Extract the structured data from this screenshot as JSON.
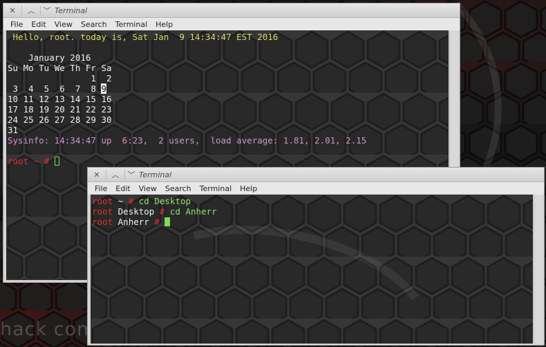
{
  "desktop": {
    "wallpaper_text": "hack computer"
  },
  "window1": {
    "title": "Terminal",
    "menu": [
      "File",
      "Edit",
      "View",
      "Search",
      "Terminal",
      "Help"
    ],
    "greeting": " Hello, root. today is, Sat Jan  9 14:34:47 EST 2016",
    "calendar": {
      "month_line": "    January 2016",
      "weekday_line": "Su Mo Tu We Th Fr Sa",
      "row1": "                1  2",
      "row2_before": " 3  4  5  6  7  8 ",
      "today": "9",
      "row3": "10 11 12 13 14 15 16",
      "row4": "17 18 19 20 21 22 23",
      "row5": "24 25 26 27 28 29 30",
      "row6": "31"
    },
    "sysinfo": "Sysinfo: 14:34:47 up  6:23,  2 users,  load average: 1.81, 2.01, 2.15",
    "prompt_user": "root",
    "prompt_dir": "~",
    "prompt_symbol": "#"
  },
  "window2": {
    "title": "Terminal",
    "menu": [
      "File",
      "Edit",
      "View",
      "Search",
      "Terminal",
      "Help"
    ],
    "lines": [
      {
        "user": "root",
        "dir": "~",
        "symbol": "#",
        "command": "cd Desktop"
      },
      {
        "user": "root",
        "dir": "Desktop",
        "symbol": "#",
        "command": "cd Anherr"
      },
      {
        "user": "root",
        "dir": "Anherr",
        "symbol": "#",
        "command": ""
      }
    ]
  },
  "colors": {
    "prompt_user": "#e0302a",
    "command_text": "#8ee06b",
    "greeting_text": "#d8d86a",
    "sysinfo_text": "#c698c8",
    "cursor": "#7ddc55"
  },
  "icons": {
    "close": "close-icon",
    "maximize": "chevron-up-icon",
    "menu": "chevron-down-icon"
  }
}
